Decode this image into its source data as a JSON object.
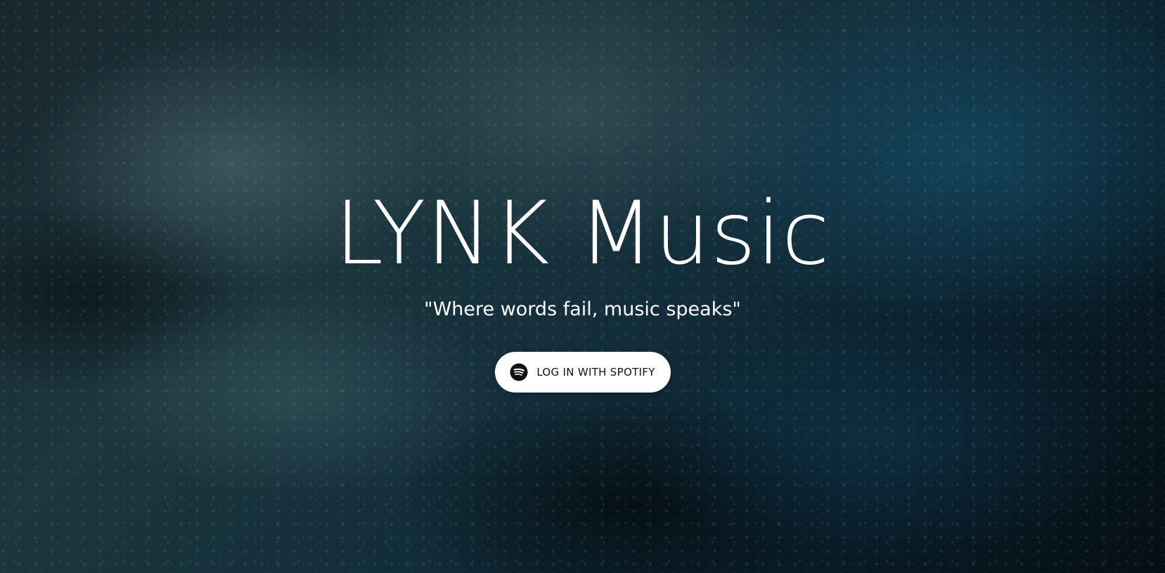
{
  "hero": {
    "title": "LYNK Music",
    "tagline": "\"Where words fail, music speaks\"",
    "login_button": {
      "label": "LOG IN WITH SPOTIFY",
      "icon": "spotify-icon"
    }
  },
  "colors": {
    "title_text": "#ffffff",
    "button_background": "#ffffff",
    "button_text": "#111111",
    "background_accent": "#1d4f63"
  }
}
